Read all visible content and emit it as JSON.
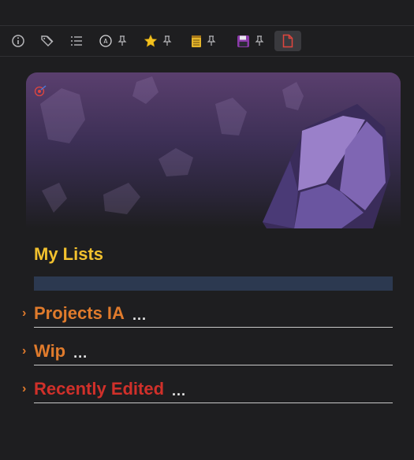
{
  "toolbar": {
    "buttons": [
      {
        "name": "info-icon"
      },
      {
        "name": "tags-icon"
      },
      {
        "name": "list-icon"
      },
      {
        "name": "badge-icon",
        "pinned": true
      },
      {
        "name": "star-icon",
        "pinned": true
      },
      {
        "name": "calendar-icon",
        "pinned": true
      },
      {
        "name": "floppy-disk-icon",
        "pinned": true
      },
      {
        "name": "document-icon",
        "active": true
      }
    ]
  },
  "colors": {
    "heading": "#f2c12e",
    "orange": "#e07b2c",
    "red": "#d0302a",
    "search_bar": "#2c3950",
    "background": "#1e1e20"
  },
  "main": {
    "heading": "My Lists",
    "lists": [
      {
        "label": "Projects IA",
        "more": "...",
        "color": "#e07b2c"
      },
      {
        "label": "Wip",
        "more": "...",
        "color": "#e07b2c"
      },
      {
        "label": "Recently Edited",
        "more": "...",
        "color": "#d0302a"
      }
    ]
  }
}
